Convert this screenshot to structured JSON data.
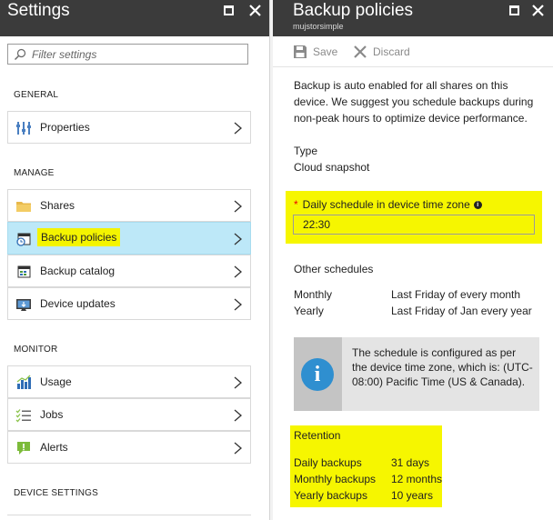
{
  "settings_blade": {
    "title": "Settings",
    "filter_placeholder": "Filter settings",
    "sections": {
      "general": "GENERAL",
      "manage": "MANAGE",
      "monitor": "MONITOR",
      "device_settings": "DEVICE SETTINGS"
    },
    "items": {
      "properties": "Properties",
      "shares": "Shares",
      "backup_policies": "Backup policies",
      "backup_catalog": "Backup catalog",
      "device_updates": "Device updates",
      "usage": "Usage",
      "jobs": "Jobs",
      "alerts": "Alerts"
    },
    "selected_item": "backup_policies"
  },
  "backup_blade": {
    "title": "Backup policies",
    "subtitle": "mujstorsimple",
    "commands": {
      "save": "Save",
      "discard": "Discard"
    },
    "description": "Backup is auto enabled for all shares on this device. We suggest you schedule backups during non-peak hours to optimize device performance.",
    "type_label": "Type",
    "type_value": "Cloud snapshot",
    "daily_schedule_label": "Daily schedule in device time zone",
    "daily_schedule_value": "22:30",
    "other_schedules_label": "Other schedules",
    "other_schedules": [
      {
        "name": "Monthly",
        "value": "Last Friday of every month"
      },
      {
        "name": "Yearly",
        "value": "Last Friday of Jan every year"
      }
    ],
    "info_message": "The schedule is configured as per the device time zone, which is: (UTC-08:00) Pacific Time (US & Canada).",
    "retention_label": "Retention",
    "retention": [
      {
        "name": "Daily backups",
        "value": "31 days"
      },
      {
        "name": "Monthly backups",
        "value": "12 months"
      },
      {
        "name": "Yearly backups",
        "value": "10 years"
      }
    ]
  },
  "colors": {
    "header_bg": "#3b3b3b",
    "selected_bg": "#bde8f8",
    "highlight": "#f6f600",
    "info_blue": "#2f8fd0"
  }
}
